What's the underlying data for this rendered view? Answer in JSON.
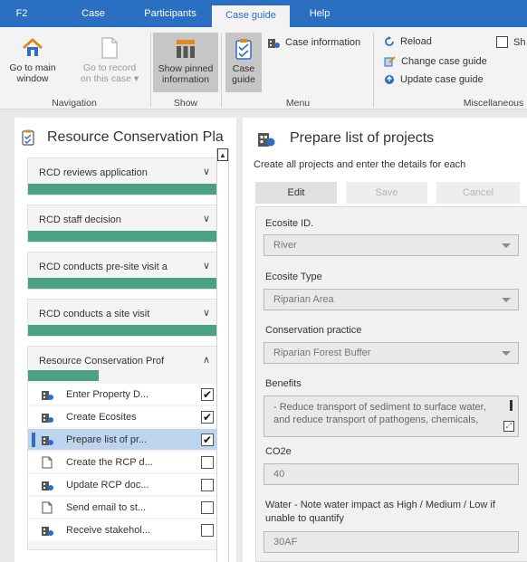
{
  "tabs": [
    {
      "label": "F2"
    },
    {
      "label": "Case"
    },
    {
      "label": "Participants"
    },
    {
      "label": "Case guide",
      "active": true
    },
    {
      "label": "Help"
    }
  ],
  "ribbon": {
    "navigation": {
      "go_main_window": {
        "line1": "Go to main",
        "line2": "window"
      },
      "go_record": {
        "line1": "Go to record",
        "line2": "on this case ▾"
      },
      "group_label": "Navigation"
    },
    "show": {
      "pinned": {
        "line1": "Show pinned",
        "line2": "information"
      },
      "group_label": "Show"
    },
    "menu": {
      "case_guide": {
        "line1": "Case",
        "line2": "guide"
      },
      "case_information": "Case information",
      "group_label": "Menu"
    },
    "misc": {
      "reload": "Reload",
      "change_case_guide": "Change case guide",
      "update_case_guide": "Update case guide",
      "show_partial": "Sh",
      "group_label": "Miscellaneous"
    }
  },
  "left_panel": {
    "title": "Resource Conservation Pla",
    "stages": [
      {
        "title": "RCD reviews application",
        "chevron": "∨",
        "progress": 1.0
      },
      {
        "title": "RCD staff decision",
        "chevron": "∨",
        "progress": 1.0
      },
      {
        "title": "RCD conducts pre-site visit a",
        "chevron": "∨",
        "progress": 1.0
      },
      {
        "title": "RCD conducts a site visit",
        "chevron": "∨",
        "progress": 1.0
      },
      {
        "title": "Resource Conservation Prof",
        "chevron": "∧",
        "progress": 0.36
      }
    ],
    "steps": [
      {
        "label": "Enter Property D...",
        "icon": "building-icon",
        "checked": "✔"
      },
      {
        "label": "Create Ecosites",
        "icon": "building-icon",
        "checked": "✔"
      },
      {
        "label": "Prepare list of pr...",
        "icon": "building-icon",
        "checked": "✔",
        "selected": true
      },
      {
        "label": "Create the RCP d...",
        "icon": "document-icon",
        "checked": ""
      },
      {
        "label": "Update RCP doc...",
        "icon": "building-icon",
        "checked": ""
      },
      {
        "label": "Send email to st...",
        "icon": "document-icon",
        "checked": ""
      },
      {
        "label": "Receive stakehol...",
        "icon": "building-icon",
        "checked": ""
      }
    ]
  },
  "right_panel": {
    "title": "Prepare list of projects",
    "description": "Create all projects and enter the details for each",
    "buttons": {
      "edit": "Edit",
      "save": "Save",
      "cancel": "Cancel"
    },
    "fields": {
      "ecosite_id": {
        "label": "Ecosite ID.",
        "value": "River"
      },
      "ecosite_type": {
        "label": "Ecosite Type",
        "value": "Riparian Area"
      },
      "conservation_practice": {
        "label": "Conservation practice",
        "value": "Riparian Forest Buffer"
      },
      "benefits": {
        "label": "Benefits",
        "value": "- Reduce transport of sediment to surface water, and reduce transport of pathogens, chemicals,"
      },
      "co2e": {
        "label": "CO2e",
        "value": "40"
      },
      "water": {
        "label": "Water - Note water impact as High / Medium / Low if unable to quantify",
        "value": "30AF"
      }
    }
  },
  "colors": {
    "accent": "#2b6fc2",
    "progress": "#4aa183",
    "selected_row": "#bcd4ee"
  }
}
